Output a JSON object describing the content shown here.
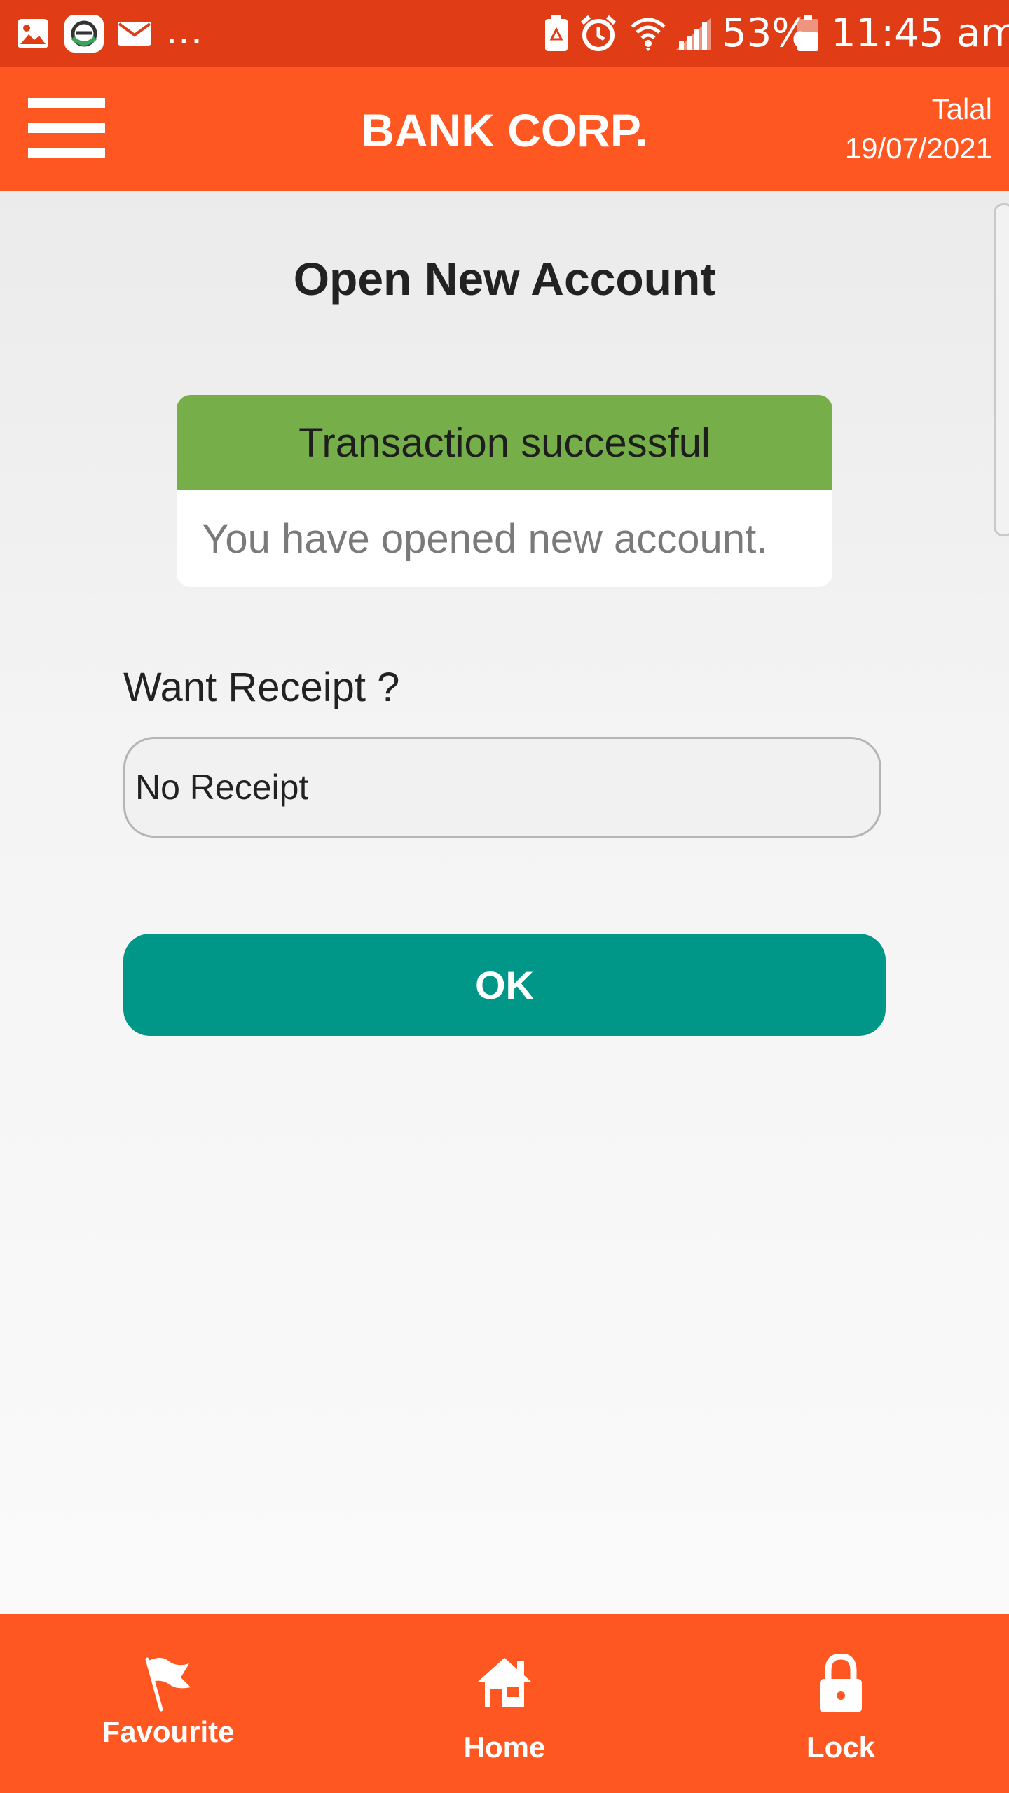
{
  "status_bar": {
    "notification_icons": [
      "gallery-icon",
      "app-icon",
      "mail-icon"
    ],
    "more_indicator": "...",
    "system_icons": [
      "battery-saver-icon",
      "alarm-icon",
      "wifi-icon",
      "signal-icon"
    ],
    "battery_percent": "53%",
    "time": "11:45 am"
  },
  "header": {
    "menu_icon": "hamburger-menu-icon",
    "title": "BANK CORP.",
    "user_name": "Talal",
    "date": "19/07/2021"
  },
  "page": {
    "title": "Open New Account",
    "message": {
      "heading": "Transaction successful",
      "body": "You have opened new account."
    },
    "receipt": {
      "label": "Want Receipt ?",
      "selected": "No Receipt"
    },
    "ok_button": "OK"
  },
  "bottom_nav": {
    "items": [
      {
        "label": "Favourite",
        "icon": "flag-icon"
      },
      {
        "label": "Home",
        "icon": "home-icon"
      },
      {
        "label": "Lock",
        "icon": "lock-icon"
      }
    ]
  },
  "colors": {
    "status_bar": "#E03C16",
    "brand": "#FF5722",
    "success": "#76AF4A",
    "primary_button": "#009688"
  }
}
